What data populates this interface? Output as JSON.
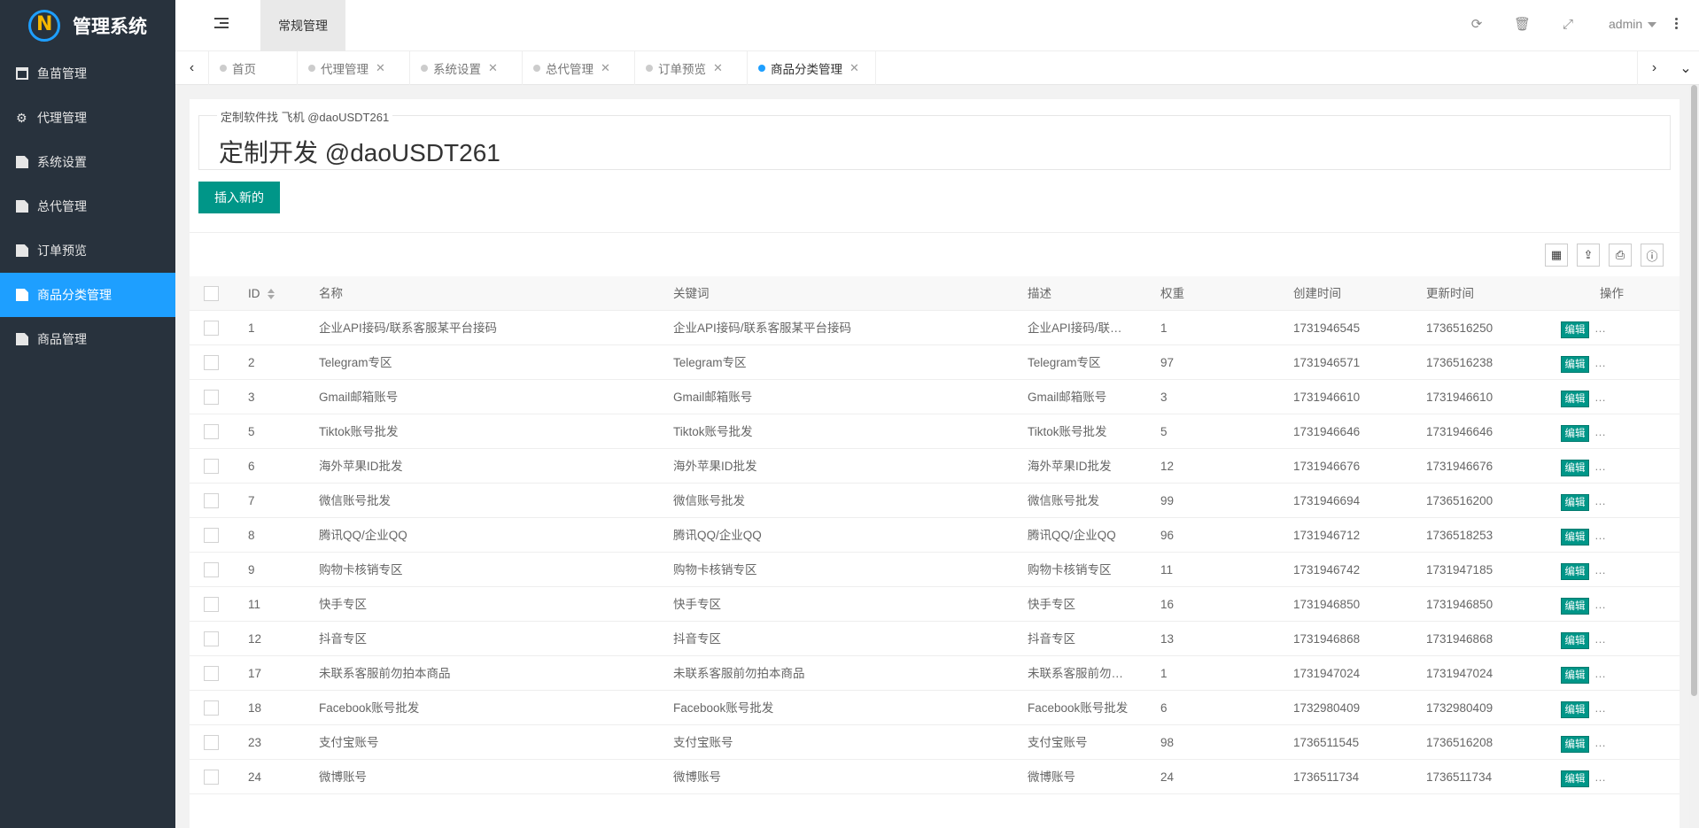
{
  "app": {
    "title": "管理系统"
  },
  "sidebar": {
    "items": [
      {
        "label": "鱼苗管理",
        "icon": "window-icon",
        "active": false
      },
      {
        "label": "代理管理",
        "icon": "gears-icon",
        "active": false
      },
      {
        "label": "系统设置",
        "icon": "document-icon",
        "active": false
      },
      {
        "label": "总代管理",
        "icon": "document-icon",
        "active": false
      },
      {
        "label": "订单预览",
        "icon": "document-icon",
        "active": false
      },
      {
        "label": "商品分类管理",
        "icon": "document-icon",
        "active": true
      },
      {
        "label": "商品管理",
        "icon": "document-icon",
        "active": false
      }
    ]
  },
  "header": {
    "top_tab": "常规管理",
    "user": "admin",
    "icons": [
      "refresh-icon",
      "trash-icon",
      "fullscreen-icon",
      "more-icon"
    ]
  },
  "tabs": [
    {
      "label": "首页",
      "closable": false
    },
    {
      "label": "代理管理",
      "closable": true
    },
    {
      "label": "系统设置",
      "closable": true
    },
    {
      "label": "总代管理",
      "closable": true
    },
    {
      "label": "订单预览",
      "closable": true
    },
    {
      "label": "商品分类管理",
      "closable": true,
      "active": true
    }
  ],
  "content": {
    "legend": "定制软件找 飞机 @daoUSDT261",
    "heading": "定制开发 @daoUSDT261",
    "insert_button": "插入新的",
    "edit_button": "编辑",
    "more": "…"
  },
  "table": {
    "columns": [
      "ID",
      "名称",
      "关键词",
      "描述",
      "权重",
      "创建时间",
      "更新时间",
      "操作"
    ],
    "rows": [
      [
        "1",
        "企业API接码/联系客服某平台接码",
        "企业API接码/联系客服某平台接码",
        "企业API接码/联…",
        "1",
        "1731946545",
        "1736516250"
      ],
      [
        "2",
        "Telegram专区",
        "Telegram专区",
        "Telegram专区",
        "97",
        "1731946571",
        "1736516238"
      ],
      [
        "3",
        "Gmail邮箱账号",
        "Gmail邮箱账号",
        "Gmail邮箱账号",
        "3",
        "1731946610",
        "1731946610"
      ],
      [
        "5",
        "Tiktok账号批发",
        "Tiktok账号批发",
        "Tiktok账号批发",
        "5",
        "1731946646",
        "1731946646"
      ],
      [
        "6",
        "海外苹果ID批发",
        "海外苹果ID批发",
        "海外苹果ID批发",
        "12",
        "1731946676",
        "1731946676"
      ],
      [
        "7",
        "微信账号批发",
        "微信账号批发",
        "微信账号批发",
        "99",
        "1731946694",
        "1736516200"
      ],
      [
        "8",
        "腾讯QQ/企业QQ",
        "腾讯QQ/企业QQ",
        "腾讯QQ/企业QQ",
        "96",
        "1731946712",
        "1736518253"
      ],
      [
        "9",
        "购物卡核销专区",
        "购物卡核销专区",
        "购物卡核销专区",
        "11",
        "1731946742",
        "1731947185"
      ],
      [
        "11",
        "快手专区",
        "快手专区",
        "快手专区",
        "16",
        "1731946850",
        "1731946850"
      ],
      [
        "12",
        "抖音专区",
        "抖音专区",
        "抖音专区",
        "13",
        "1731946868",
        "1731946868"
      ],
      [
        "17",
        "未联系客服前勿拍本商品",
        "未联系客服前勿拍本商品",
        "未联系客服前勿…",
        "1",
        "1731947024",
        "1731947024"
      ],
      [
        "18",
        "Facebook账号批发",
        "Facebook账号批发",
        "Facebook账号批发",
        "6",
        "1732980409",
        "1732980409"
      ],
      [
        "23",
        "支付宝账号",
        "支付宝账号",
        "支付宝账号",
        "98",
        "1736511545",
        "1736516208"
      ],
      [
        "24",
        "微博账号",
        "微博账号",
        "微博账号",
        "24",
        "1736511734",
        "1736511734"
      ]
    ]
  },
  "colors": {
    "sidebar_bg": "#28323d",
    "active": "#1e9fff",
    "primary_button": "#009688"
  }
}
